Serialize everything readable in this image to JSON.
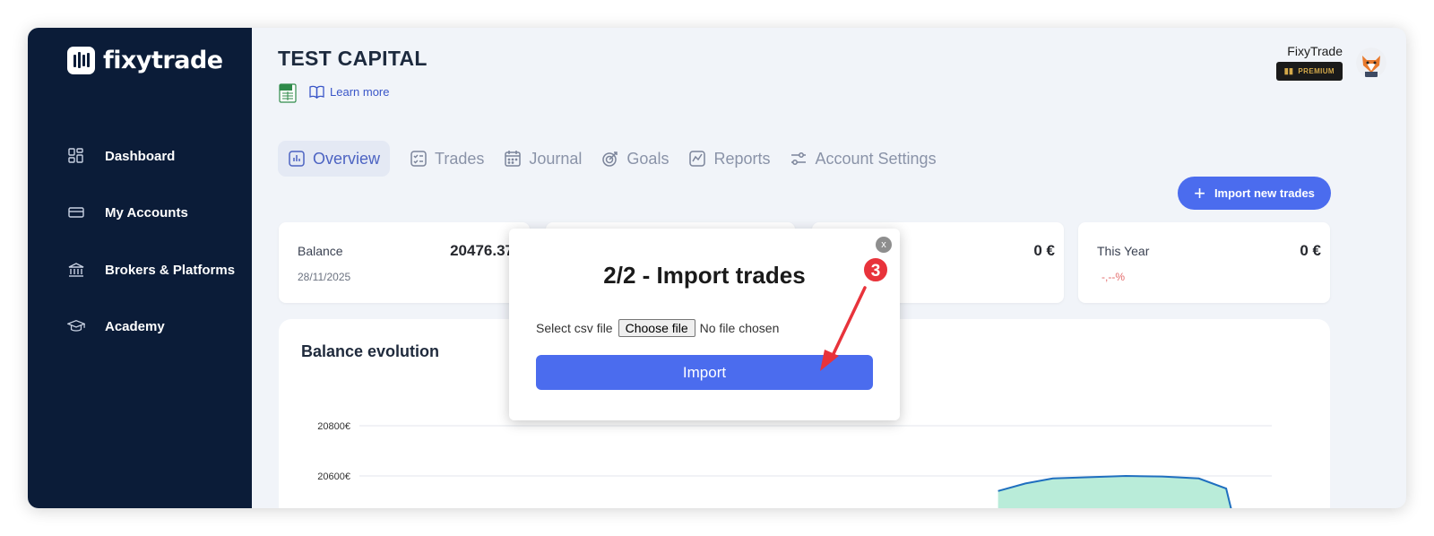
{
  "app": {
    "logo_text": "fixytrade"
  },
  "sidebar": {
    "items": [
      {
        "label": "Dashboard",
        "icon": "dashboard-icon"
      },
      {
        "label": "My Accounts",
        "icon": "card-icon"
      },
      {
        "label": "Brokers & Platforms",
        "icon": "bank-icon"
      },
      {
        "label": "Academy",
        "icon": "graduation-cap-icon"
      }
    ]
  },
  "header": {
    "title": "TEST CAPITAL",
    "learn_more": "Learn more",
    "user_name": "FixyTrade",
    "badge": "PREMIUM"
  },
  "tabs": [
    {
      "label": "Overview",
      "active": true
    },
    {
      "label": "Trades"
    },
    {
      "label": "Journal"
    },
    {
      "label": "Goals"
    },
    {
      "label": "Reports"
    },
    {
      "label": "Account Settings"
    }
  ],
  "import_button": {
    "label": "Import new trades"
  },
  "cards": {
    "balance": {
      "label": "Balance",
      "date": "28/11/2025",
      "value": "20476.37"
    },
    "third": {
      "value": "0 €"
    },
    "year": {
      "label": "This Year",
      "value": "0 €",
      "pct": "-,--%"
    }
  },
  "chart_data": {
    "type": "area",
    "title": "Balance evolution",
    "y_ticks": [
      "20800€",
      "20600€"
    ],
    "x": [
      0.7,
      0.73,
      0.76,
      0.8,
      0.84,
      0.88,
      0.92,
      0.95
    ],
    "values": [
      20540,
      20570,
      20590,
      20595,
      20600,
      20598,
      20590,
      20550
    ]
  },
  "modal": {
    "title": "2/2 - Import trades",
    "file_label": "Select csv file",
    "choose_button": "Choose file",
    "no_file": "No file chosen",
    "import_button": "Import",
    "close": "x"
  },
  "annotation": {
    "step": "3",
    "color": "#e8333b"
  },
  "colors": {
    "sidebar": "#0b1c38",
    "accent": "#4b6cee",
    "area_fill": "#b9ecd9",
    "line": "#1f6fbf"
  }
}
